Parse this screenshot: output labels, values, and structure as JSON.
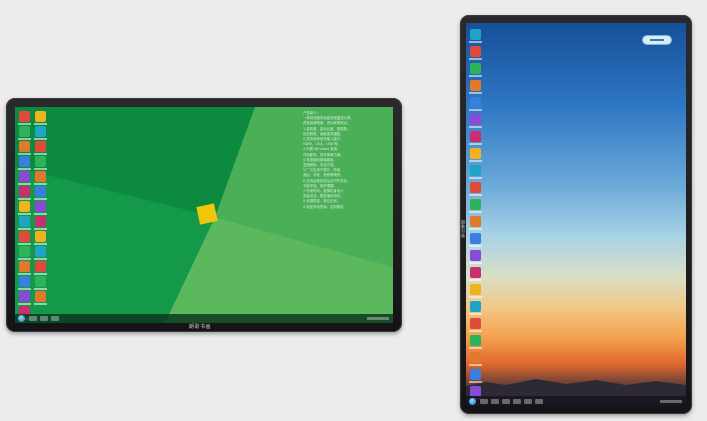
{
  "landscape_screen": {
    "brand_label": "朗歌书画",
    "description_lines": [
      "产品简介：",
      "一体机电脑采用高清液晶显示屏，",
      "具有高清晰度、低功耗等特点。",
      "1.高亮度、高对比度、宽视角，",
      "色彩鲜艳，画面逼真细腻。",
      "2.支持多种信号输入接口，",
      "HDMI、VGA、USB 等。",
      "3.内置 Windows 系统，",
      "开机即用，操作简单方便。",
      "4.采用钢化玻璃面板，",
      "坚固耐用，安全可靠。",
      "5.广泛应用于展厅、商场、",
      "酒店、学校、医院等场所。",
      "6.支持远程控制及定时开关机，",
      "节能环保，维护便捷。",
      "7.外观时尚，超薄机身设计，",
      "安装灵活，壁挂落地均可。",
      "8.全国联保，售后无忧。",
      "9.欢迎来电咨询，定制服务。"
    ],
    "icons_col_a": [
      "app-icon",
      "app-icon",
      "app-icon",
      "app-icon",
      "app-icon",
      "app-icon",
      "app-icon",
      "app-icon",
      "app-icon",
      "app-icon",
      "app-icon",
      "app-icon",
      "app-icon",
      "ie-icon"
    ],
    "icons_col_b": [
      "app-icon",
      "app-icon",
      "app-icon",
      "app-icon",
      "app-icon",
      "app-icon",
      "app-icon",
      "app-icon",
      "app-icon",
      "app-icon",
      "app-icon",
      "app-icon",
      "app-icon"
    ]
  },
  "portrait_screen": {
    "brand_label": "朗歌书画",
    "icon_count": 22
  },
  "colors": {
    "green_dark": "#0f8f43",
    "green_mid": "#1fa650",
    "green_light": "#5bb85c",
    "logo_yellow": "#f2c60c",
    "bezel": "#1b1b1d"
  }
}
